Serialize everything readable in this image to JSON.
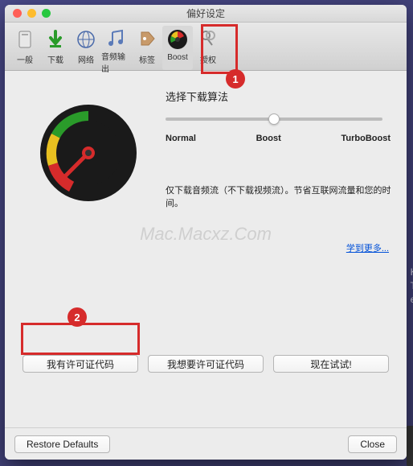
{
  "window": {
    "title": "偏好设定"
  },
  "toolbar": {
    "items": [
      {
        "label": "一般"
      },
      {
        "label": "下载"
      },
      {
        "label": "网络"
      },
      {
        "label": "音频输出"
      },
      {
        "label": "标签"
      },
      {
        "label": "Boost"
      },
      {
        "label": "授权"
      }
    ]
  },
  "content": {
    "section_title": "选择下载算法",
    "slider": {
      "labels": [
        "Normal",
        "Boost",
        "TurboBoost"
      ]
    },
    "description": "仅下载音频流（不下载视频流）。节省互联网流量和您的时间。",
    "learn_more": "学到更多...",
    "watermark": "Mac.Macxz.Com"
  },
  "buttons": {
    "license_have": "我有许可证代码",
    "license_want": "我想要许可证代码",
    "try_now": "现在试试!"
  },
  "footer": {
    "restore": "Restore Defaults",
    "close": "Close"
  },
  "annotations": {
    "badge1": "1",
    "badge2": "2"
  },
  "bg_text": {
    "l1": "K.c",
    "l2": "Tik",
    "l3": "ew"
  }
}
